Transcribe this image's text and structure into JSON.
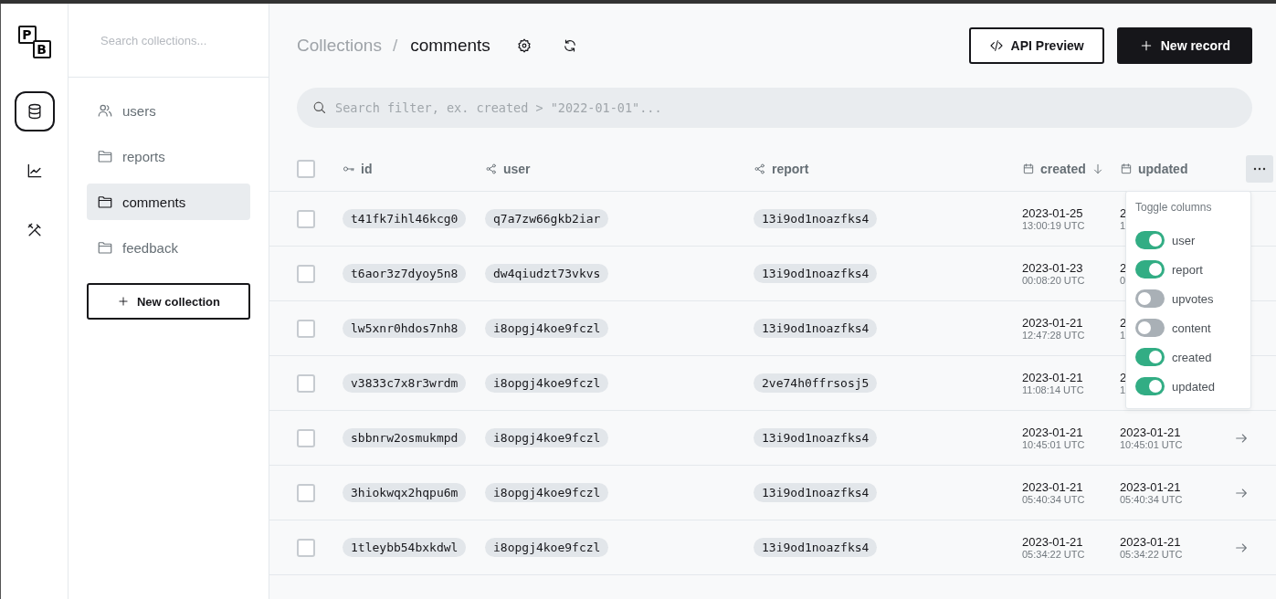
{
  "rail": {
    "logo": {
      "letters": [
        "P",
        "B"
      ]
    },
    "items": [
      {
        "kind": "database",
        "selected": true
      },
      {
        "kind": "chart",
        "selected": false
      },
      {
        "kind": "tools",
        "selected": false
      }
    ]
  },
  "sidebar": {
    "search": {
      "placeholder": "Search collections..."
    },
    "items": [
      {
        "label": "users",
        "kind": "auth",
        "selected": false
      },
      {
        "label": "reports",
        "kind": "base",
        "selected": false
      },
      {
        "label": "comments",
        "kind": "base",
        "selected": true
      },
      {
        "label": "feedback",
        "kind": "base",
        "selected": false
      }
    ],
    "new_button": "New collection"
  },
  "header": {
    "breadcrumb": {
      "parent": "Collections",
      "separator": "/",
      "current": "comments"
    },
    "api_button": "API Preview",
    "new_button": "New record"
  },
  "filter": {
    "placeholder": "Search filter, ex. created > \"2022-01-01\"..."
  },
  "table": {
    "select_all": false,
    "columns": [
      {
        "label": "id",
        "kind": "key",
        "sorted": false
      },
      {
        "label": "user",
        "kind": "relation",
        "sorted": false
      },
      {
        "label": "report",
        "kind": "relation",
        "sorted": false
      },
      {
        "label": "created",
        "kind": "date",
        "sorted": true
      },
      {
        "label": "updated",
        "kind": "date",
        "sorted": false
      }
    ],
    "rows": [
      {
        "selected": false,
        "id": "t41fk7ihl46kcg0",
        "user": "q7a7zw66gkb2iar",
        "report": "13i9od1noazfks4",
        "created": {
          "date": "2023-01-25",
          "time": "13:00:19 UTC"
        },
        "updated": {
          "date": "2",
          "time": "1"
        }
      },
      {
        "selected": false,
        "id": "t6aor3z7dyoy5n8",
        "user": "dw4qiudzt73vkvs",
        "report": "13i9od1noazfks4",
        "created": {
          "date": "2023-01-23",
          "time": "00:08:20 UTC"
        },
        "updated": {
          "date": "2",
          "time": "0"
        }
      },
      {
        "selected": false,
        "id": "lw5xnr0hdos7nh8",
        "user": "i8opgj4koe9fczl",
        "report": "13i9od1noazfks4",
        "created": {
          "date": "2023-01-21",
          "time": "12:47:28 UTC"
        },
        "updated": {
          "date": "2",
          "time": "1"
        }
      },
      {
        "selected": false,
        "id": "v3833c7x8r3wrdm",
        "user": "i8opgj4koe9fczl",
        "report": "2ve74h0ffrsosj5",
        "created": {
          "date": "2023-01-21",
          "time": "11:08:14 UTC"
        },
        "updated": {
          "date": "2",
          "time": "1"
        }
      },
      {
        "selected": false,
        "id": "sbbnrw2osmukmpd",
        "user": "i8opgj4koe9fczl",
        "report": "13i9od1noazfks4",
        "created": {
          "date": "2023-01-21",
          "time": "10:45:01 UTC"
        },
        "updated": {
          "date": "2023-01-21",
          "time": "10:45:01 UTC"
        }
      },
      {
        "selected": false,
        "id": "3hiokwqx2hqpu6m",
        "user": "i8opgj4koe9fczl",
        "report": "13i9od1noazfks4",
        "created": {
          "date": "2023-01-21",
          "time": "05:40:34 UTC"
        },
        "updated": {
          "date": "2023-01-21",
          "time": "05:40:34 UTC"
        }
      },
      {
        "selected": false,
        "id": "1tleybb54bxkdwl",
        "user": "i8opgj4koe9fczl",
        "report": "13i9od1noazfks4",
        "created": {
          "date": "2023-01-21",
          "time": "05:34:22 UTC"
        },
        "updated": {
          "date": "2023-01-21",
          "time": "05:34:22 UTC"
        }
      }
    ]
  },
  "column_menu": {
    "title": "Toggle columns",
    "items": [
      {
        "label": "user",
        "on": true
      },
      {
        "label": "report",
        "on": true
      },
      {
        "label": "upvotes",
        "on": false
      },
      {
        "label": "content",
        "on": false
      },
      {
        "label": "created",
        "on": true
      },
      {
        "label": "updated",
        "on": true
      }
    ]
  }
}
